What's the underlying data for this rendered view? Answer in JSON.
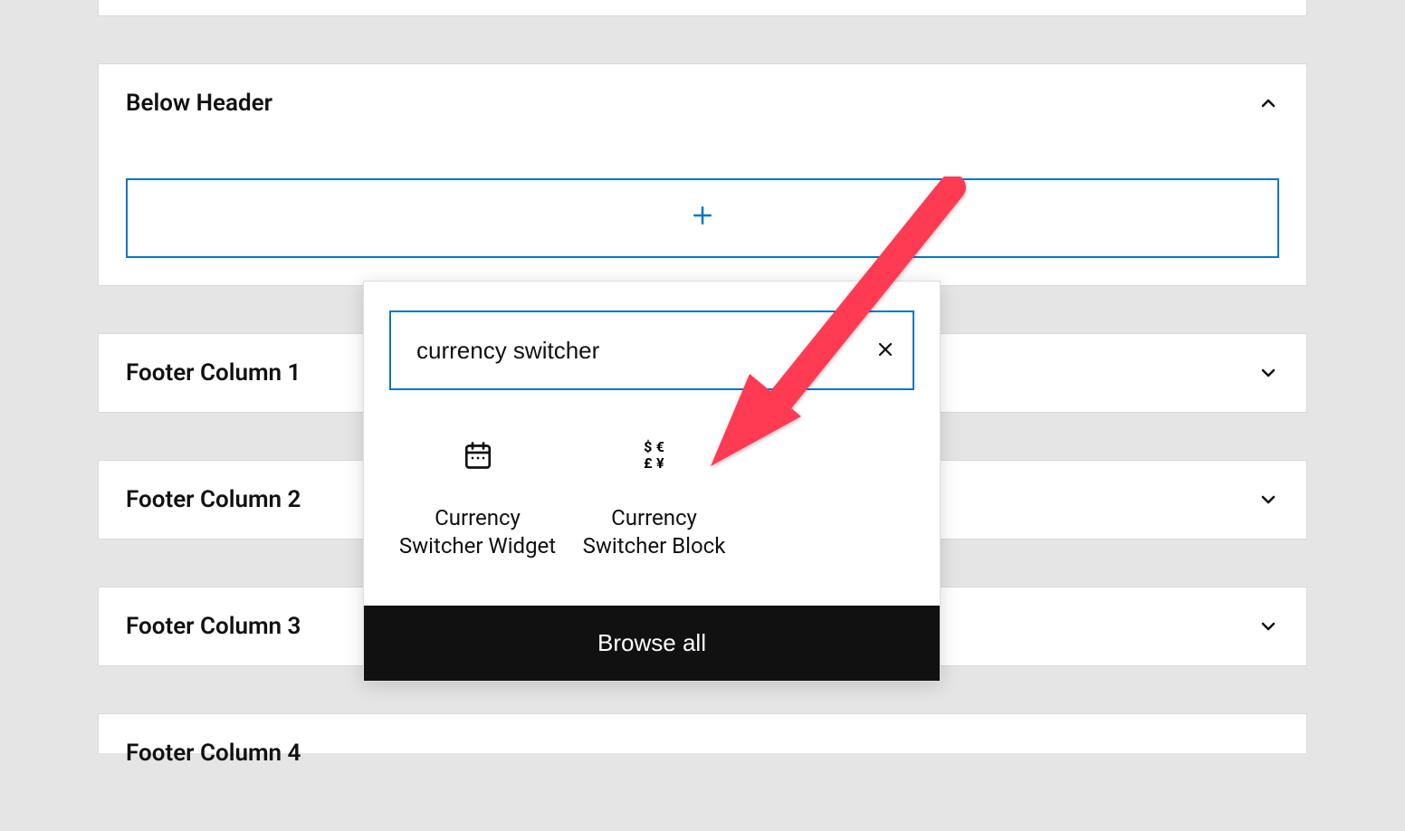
{
  "panels": {
    "belowHeader": {
      "title": "Below Header"
    },
    "footerColumn1": {
      "title": "Footer Column 1"
    },
    "footerColumn2": {
      "title": "Footer Column 2"
    },
    "footerColumn3": {
      "title": "Footer Column 3"
    },
    "footerColumn4": {
      "title": "Footer Column 4"
    }
  },
  "inserter": {
    "searchValue": "currency switcher",
    "results": [
      {
        "label": "Currency Switcher Widget",
        "icon": "calendar-legacy-icon"
      },
      {
        "label": "Currency Switcher Block",
        "icon": "currency-symbols-icon"
      }
    ],
    "browseAll": "Browse all"
  }
}
